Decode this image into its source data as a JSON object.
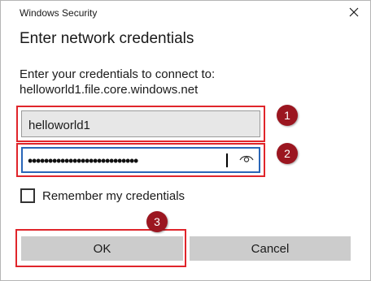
{
  "window": {
    "title": "Windows Security",
    "close_glyph": "✕"
  },
  "dialog": {
    "heading": "Enter network credentials",
    "prompt_line1": "Enter your credentials to connect to:",
    "prompt_line2": "helloworld1.file.core.windows.net"
  },
  "username": {
    "value": "helloworld1"
  },
  "password": {
    "masked_value": "•••••••••••••••••••••••••••",
    "reveal_icon": "eye-icon"
  },
  "remember": {
    "label": "Remember my credentials",
    "checked": false
  },
  "buttons": {
    "ok_label": "OK",
    "cancel_label": "Cancel"
  },
  "annotations": [
    {
      "number": "1",
      "color": "#9b1620"
    },
    {
      "number": "2",
      "color": "#9b1620"
    },
    {
      "number": "3",
      "color": "#9b1620"
    }
  ],
  "colors": {
    "annotation_border": "#e0252b",
    "focus_border": "#2a66b8",
    "button_bg": "#cccccc"
  }
}
